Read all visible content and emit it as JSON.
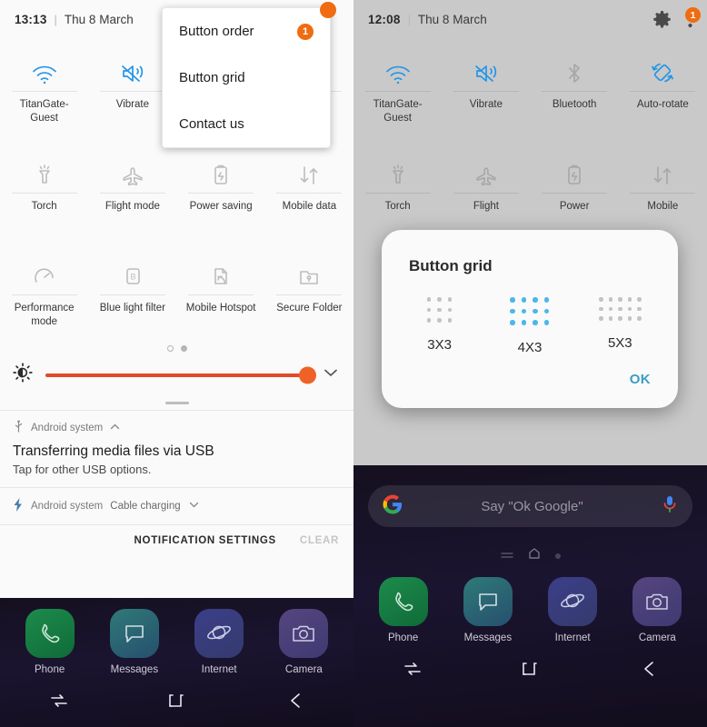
{
  "left_panel": {
    "status_bar": {
      "time": "13:13",
      "separator": "|",
      "date": "Thu 8 March"
    },
    "tiles_row1": [
      {
        "label": "TitanGate-Guest",
        "icon": "wifi-icon",
        "state": "on"
      },
      {
        "label": "Vibrate",
        "icon": "vibrate-icon",
        "state": "on"
      },
      {
        "label": "",
        "icon": "bluetooth-icon",
        "state": "off"
      },
      {
        "label": "",
        "icon": "auto-rotate-icon",
        "state": "off"
      }
    ],
    "tiles_row2": [
      {
        "label": "Torch",
        "icon": "torch-icon",
        "state": "off"
      },
      {
        "label": "Flight mode",
        "icon": "airplane-icon",
        "state": "off"
      },
      {
        "label": "Power saving",
        "icon": "battery-saver-icon",
        "state": "off"
      },
      {
        "label": "Mobile data",
        "icon": "data-transfer-icon",
        "state": "off"
      }
    ],
    "tiles_row3": [
      {
        "label": "Performance mode",
        "icon": "speedometer-icon",
        "state": "off"
      },
      {
        "label": "Blue light filter",
        "icon": "blue-light-icon",
        "state": "off"
      },
      {
        "label": "Mobile Hotspot",
        "icon": "hotspot-icon",
        "state": "off"
      },
      {
        "label": "Secure Folder",
        "icon": "secure-folder-icon",
        "state": "off"
      }
    ],
    "brightness": {
      "icon": "brightness-icon",
      "value_pct": 92,
      "expand_icon": "chevron-down-icon"
    },
    "notification_1": {
      "app": "Android system",
      "app_icon": "usb-icon",
      "collapse_icon": "chevron-up-icon",
      "title": "Transferring media files via USB",
      "subtitle": "Tap for other USB options."
    },
    "notification_2": {
      "app": "Android system",
      "app_icon": "charging-bolt-icon",
      "status": "Cable charging",
      "expand_icon": "chevron-down-icon"
    },
    "footer": {
      "settings_label": "NOTIFICATION SETTINGS",
      "clear_label": "CLEAR"
    },
    "popup_menu": {
      "items": [
        {
          "label": "Button order",
          "badge": "1"
        },
        {
          "label": "Button grid",
          "badge": ""
        },
        {
          "label": "Contact us",
          "badge": ""
        }
      ]
    }
  },
  "right_panel": {
    "status_bar": {
      "time": "12:08",
      "separator": "|",
      "date": "Thu 8 March",
      "settings_icon": "gear-icon",
      "menu_icon": "overflow-menu-icon",
      "menu_badge": "1"
    },
    "tiles_row1": [
      {
        "label": "TitanGate-Guest",
        "icon": "wifi-icon",
        "state": "on"
      },
      {
        "label": "Vibrate",
        "icon": "vibrate-icon",
        "state": "on"
      },
      {
        "label": "Bluetooth",
        "icon": "bluetooth-icon",
        "state": "off"
      },
      {
        "label": "Auto-rotate",
        "icon": "auto-rotate-icon",
        "state": "on"
      }
    ],
    "tiles_row2": [
      {
        "label": "Torch",
        "icon": "torch-icon",
        "state": "off"
      },
      {
        "label": "Flight",
        "icon": "airplane-icon",
        "state": "off"
      },
      {
        "label": "Power",
        "icon": "battery-saver-icon",
        "state": "off"
      },
      {
        "label": "Mobile",
        "icon": "data-transfer-icon",
        "state": "off"
      }
    ],
    "dialog": {
      "title": "Button grid",
      "options": [
        {
          "label": "3X3",
          "cols": 3,
          "rows": 3,
          "selected": false
        },
        {
          "label": "4X3",
          "cols": 4,
          "rows": 3,
          "selected": true
        },
        {
          "label": "5X3",
          "cols": 5,
          "rows": 3,
          "selected": false
        }
      ],
      "ok_label": "OK"
    },
    "home": {
      "search_placeholder": "Say \"Ok Google\"",
      "google_icon": "google-g-icon",
      "mic_icon": "microphone-icon",
      "dock": [
        {
          "label": "Phone",
          "icon": "phone-icon",
          "color": "#1a8a4a"
        },
        {
          "label": "Messages",
          "icon": "message-icon",
          "color": "#2d6a6e"
        },
        {
          "label": "Internet",
          "icon": "internet-planet-icon",
          "color": "#3a3b82"
        },
        {
          "label": "Camera",
          "icon": "camera-icon",
          "color": "#4a3f78"
        }
      ],
      "nav": [
        {
          "icon": "recents-icon"
        },
        {
          "icon": "home-square-icon"
        },
        {
          "icon": "back-arrow-icon"
        }
      ]
    }
  },
  "colors": {
    "accent_blue": "#2196e8",
    "badge_orange": "#ef6c10",
    "slider_red": "#e24a2b",
    "dialog_blue": "#4ab8e8",
    "ok_blue": "#3a9dc4"
  }
}
